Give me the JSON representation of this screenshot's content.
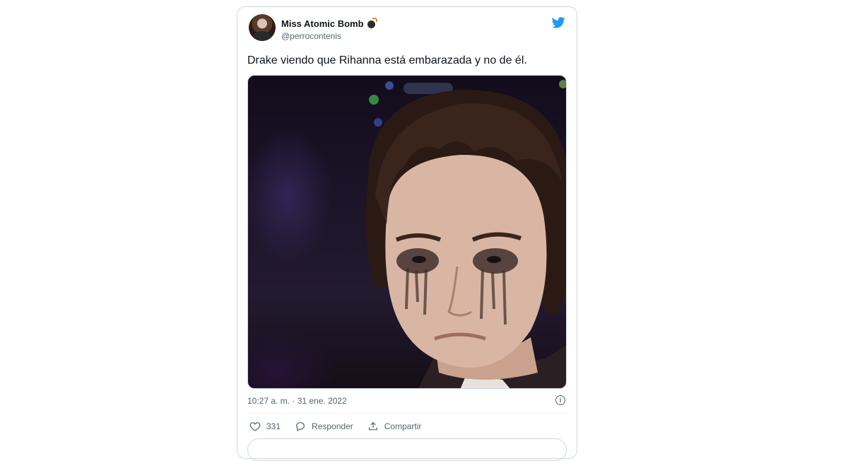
{
  "tweet": {
    "display_name": "Miss Atomic Bomb",
    "handle": "@perrocontenis",
    "text": "Drake viendo que Rihanna está embarazada y no de él.",
    "timestamp": "10:27 a. m. · 31 ene. 2022",
    "like_count": "331",
    "reply_label": "Responder",
    "share_label": "Compartir"
  },
  "icons": {
    "brand": "twitter-bird-icon",
    "name_emoji": "bomb-icon",
    "info": "info-icon",
    "like": "heart-icon",
    "reply": "reply-bubble-icon",
    "share": "share-upload-icon"
  },
  "colors": {
    "brand_blue": "#1d9bf0",
    "text_primary": "#0f1419",
    "text_secondary": "#536471",
    "border": "#cfd9de"
  }
}
